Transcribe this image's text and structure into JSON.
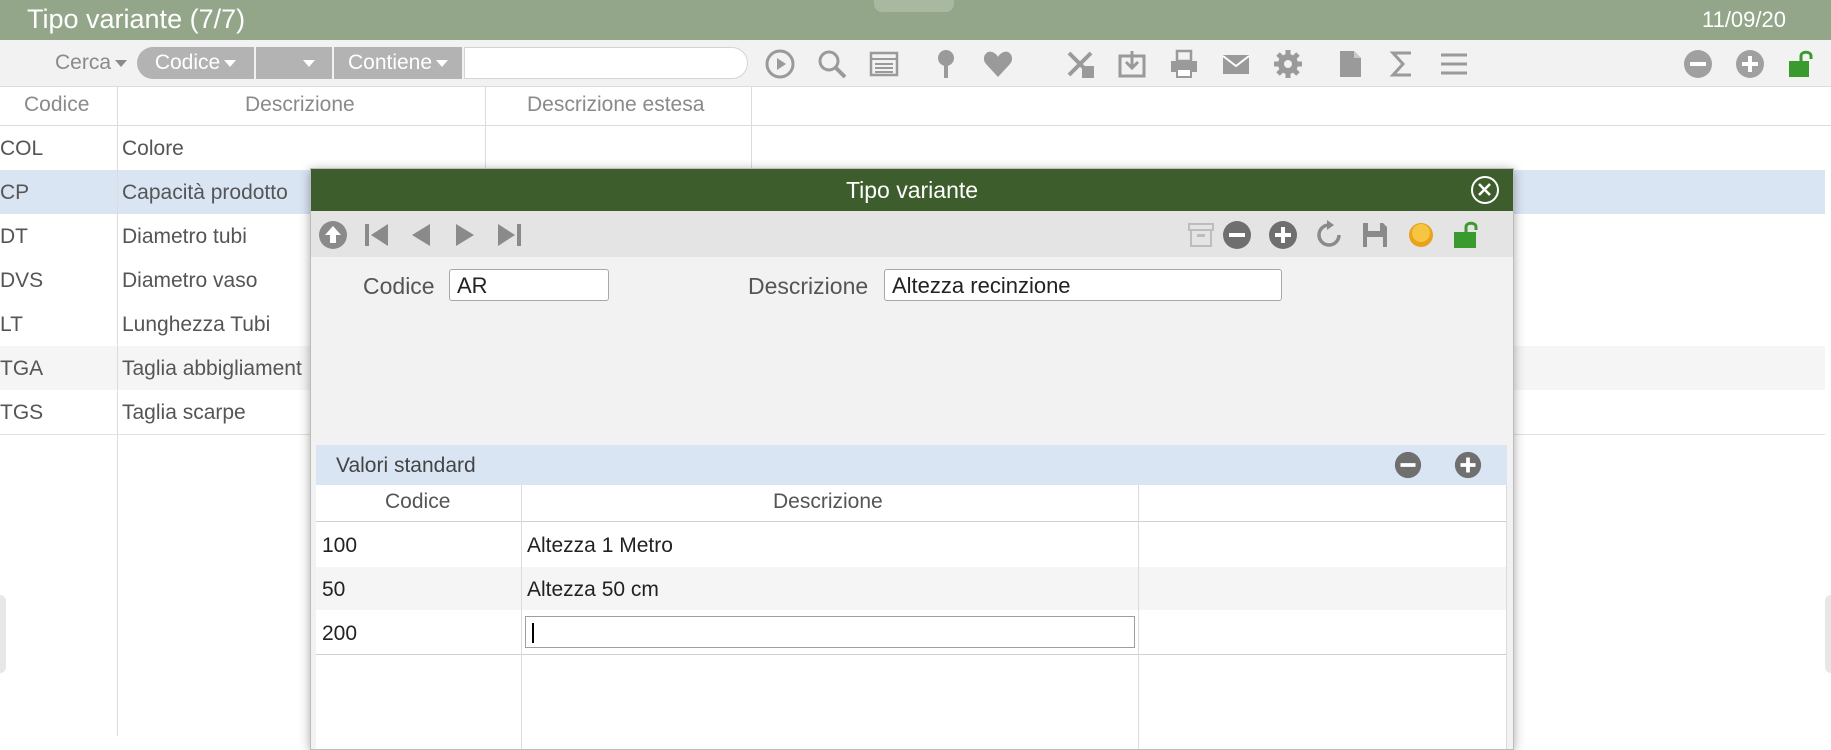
{
  "window": {
    "title": "Tipo variante (7/7)",
    "date": "11/09/20"
  },
  "toolbar": {
    "cerca_label": "Cerca",
    "field_selector": "Codice",
    "empty_selector": "",
    "operator_selector": "Contiene",
    "search_value": ""
  },
  "list": {
    "columns": [
      "Codice",
      "Descrizione",
      "Descrizione estesa"
    ],
    "rows": [
      {
        "code": "COL",
        "description": "Colore"
      },
      {
        "code": "CP",
        "description": "Capacità prodotto"
      },
      {
        "code": "DT",
        "description": "Diametro tubi"
      },
      {
        "code": "DVS",
        "description": "Diametro vaso"
      },
      {
        "code": "LT",
        "description": "Lunghezza Tubi"
      },
      {
        "code": "TGA",
        "description": "Taglia abbigliament"
      },
      {
        "code": "TGS",
        "description": "Taglia scarpe"
      }
    ],
    "selected_row": "CP"
  },
  "modal": {
    "title": "Tipo variante",
    "codice_label": "Codice",
    "codice_value": "AR",
    "descrizione_label": "Descrizione",
    "descrizione_value": "Altezza recinzione",
    "subpanel": {
      "title": "Valori standard",
      "columns": [
        "Codice",
        "Descrizione"
      ],
      "rows": [
        {
          "code": "100",
          "description": "Altezza 1 Metro"
        },
        {
          "code": "50",
          "description": "Altezza 50 cm"
        },
        {
          "code": "200",
          "description": ""
        }
      ]
    }
  },
  "colors": {
    "title_bar": "#93a68a",
    "modal_header": "#3d5e2c",
    "selected_row": "#dae5f4",
    "unlock_green": "#3b9a2e",
    "icon_gray": "#8a8a8a"
  },
  "icons": {
    "toolbar": [
      "play-circle-icon",
      "search-icon",
      "list-icon",
      "pin-icon",
      "heart-icon",
      "excel-icon",
      "download-icon",
      "print-icon",
      "mail-icon",
      "gear-icon",
      "document-icon",
      "sigma-icon",
      "menu-icon",
      "minus-circle-icon",
      "plus-circle-icon",
      "unlock-icon"
    ],
    "modal_toolbar": [
      "upload-circle-icon",
      "first-record-icon",
      "previous-icon",
      "next-icon",
      "last-record-icon",
      "archive-icon",
      "minus-circle-icon",
      "plus-circle-icon",
      "refresh-icon",
      "save-icon",
      "coin-icon",
      "unlock-icon"
    ]
  }
}
